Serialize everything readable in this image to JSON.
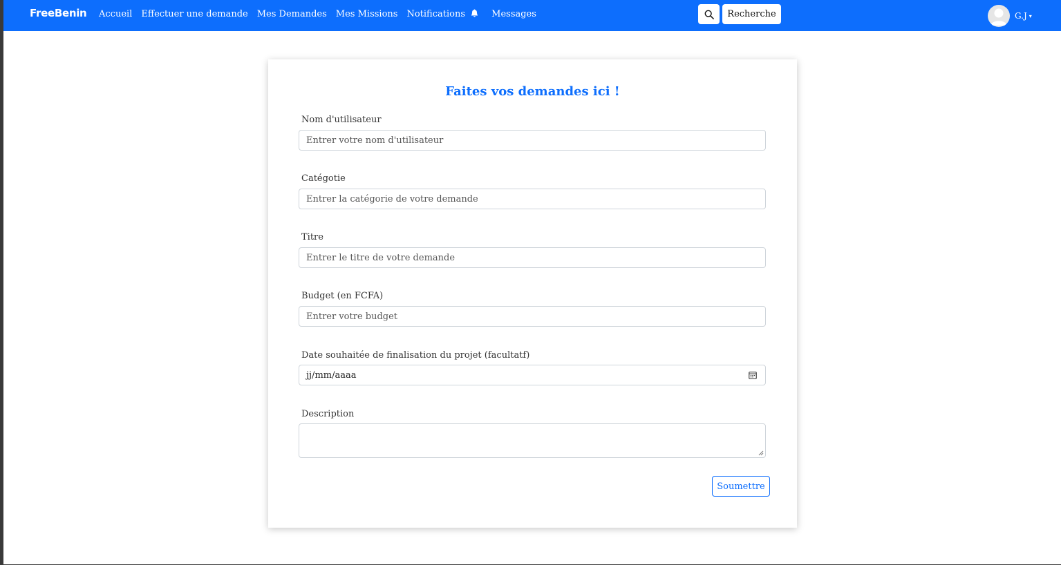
{
  "navbar": {
    "brand": "FreeBenin",
    "links": [
      "Accueil",
      "Effectuer une demande",
      "Mes Demandes",
      "Mes Missions",
      "Notifications",
      "Messages"
    ],
    "search_button_label": "Recherche",
    "user_name": "G.J",
    "color": "#0d6efd"
  },
  "form": {
    "title": "Faites vos demandes ici !",
    "fields": [
      {
        "label": "Nom d'utilisateur",
        "placeholder": "Entrer votre nom d'utilisateur"
      },
      {
        "label": "Catégotie",
        "placeholder": "Entrer la catégorie de votre demande"
      },
      {
        "label": "Titre",
        "placeholder": "Entrer le titre de votre demande"
      },
      {
        "label": "Budget (en FCFA)",
        "placeholder": "Entrer votre budget"
      },
      {
        "label": "Date souhaitée de finalisation du projet (facultatf)",
        "placeholder": "jj/mm/aaaa"
      },
      {
        "label": "Description",
        "placeholder": ""
      }
    ],
    "submit_label": "Soumettre"
  },
  "icons": {
    "notifications": "bell-icon",
    "search": "search-icon",
    "date": "calendar-icon",
    "avatar": "user-avatar-icon"
  }
}
